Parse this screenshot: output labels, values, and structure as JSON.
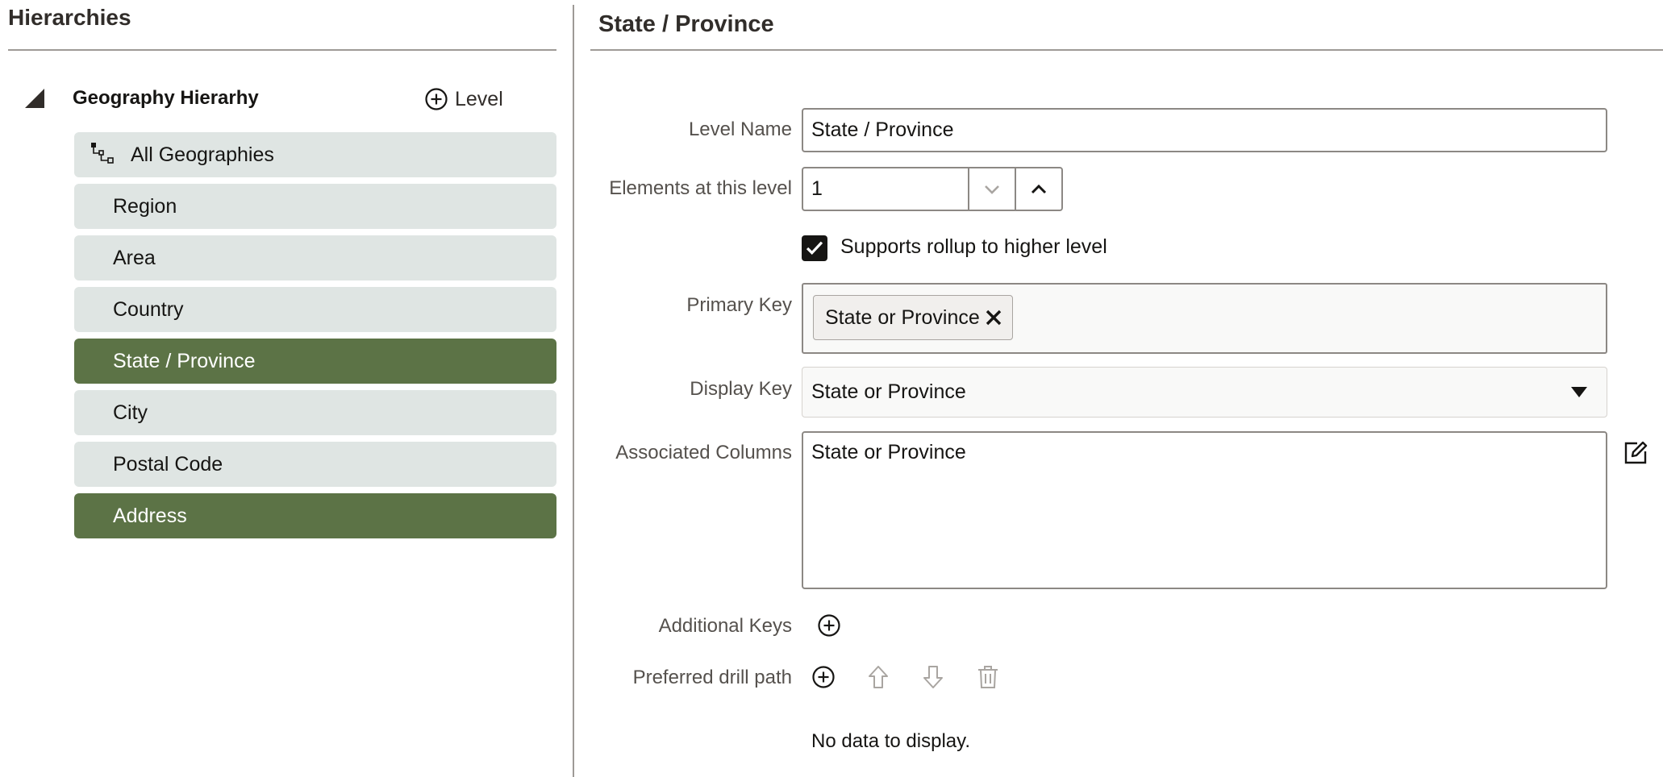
{
  "left": {
    "title": "Hierarchies",
    "hierarchy_name": "Geography Hierarhy",
    "add_level_label": "Level",
    "levels": [
      {
        "label": "All Geographies",
        "root": true,
        "selected": false
      },
      {
        "label": "Region",
        "selected": false
      },
      {
        "label": "Area",
        "selected": false
      },
      {
        "label": "Country",
        "selected": false
      },
      {
        "label": "State / Province",
        "selected": true
      },
      {
        "label": "City",
        "selected": false
      },
      {
        "label": "Postal Code",
        "selected": false
      },
      {
        "label": "Address",
        "selected": true
      }
    ]
  },
  "right": {
    "title": "State / Province",
    "level_name": {
      "label": "Level Name",
      "value": "State / Province"
    },
    "elements": {
      "label": "Elements at this level",
      "value": "1"
    },
    "rollup": {
      "label": "Supports rollup to higher level",
      "checked": true
    },
    "primary_key": {
      "label": "Primary Key",
      "chips": [
        "State or Province"
      ]
    },
    "display_key": {
      "label": "Display Key",
      "value": "State or Province"
    },
    "associated_columns": {
      "label": "Associated Columns",
      "value": "State or Province"
    },
    "additional_keys": {
      "label": "Additional Keys"
    },
    "drill_path": {
      "label": "Preferred drill path",
      "empty_text": "No data to display."
    }
  },
  "colors": {
    "selected_bg": "#5c7346",
    "item_bg": "#dfe5e3",
    "text": "#161513",
    "label": "#55514d",
    "disabled_icon": "#a9a5a1"
  },
  "icons": {
    "collapse": "triangle-collapse-icon",
    "add": "plus-circle-icon",
    "tree": "tree-structure-icon",
    "remove": "x-icon",
    "dropdown": "caret-down-icon",
    "edit": "edit-pencil-icon",
    "up": "arrow-up-icon",
    "down": "arrow-down-icon",
    "delete": "trash-icon"
  }
}
